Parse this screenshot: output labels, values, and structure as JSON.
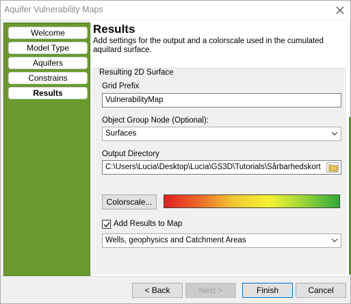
{
  "window": {
    "title": "Aquifer Vulnerability Maps"
  },
  "sidebar": {
    "items": [
      {
        "label": "Welcome",
        "active": false
      },
      {
        "label": "Model Type",
        "active": false
      },
      {
        "label": "Aquifers",
        "active": false
      },
      {
        "label": "Constrains",
        "active": false
      },
      {
        "label": "Results",
        "active": true
      }
    ],
    "background_color": "#6a9a2f"
  },
  "header": {
    "title": "Results",
    "description": "Add settings for the output and a colorscale used in the cumulated aquitard surface."
  },
  "group": {
    "label": "Resulting 2D Surface",
    "grid_prefix": {
      "label": "Grid Prefix",
      "value": "VulnerabilityMap"
    },
    "object_group_node": {
      "label": "Object Group Node (Optional):",
      "value": "Surfaces"
    },
    "output_directory": {
      "label": "Output Directory",
      "value": "C:\\Users\\Lucia\\Desktop\\Lucia\\GS3D\\Tutorials\\Sårbarhedskort"
    },
    "colorscale_button": "Colorscale...",
    "colorscale_colors": [
      "#e02020",
      "#ec6a2a",
      "#f0c832",
      "#f2f232",
      "#9ad43a",
      "#2ea83a"
    ],
    "add_results": {
      "label": "Add Results to Map",
      "checked": true
    },
    "map_select": {
      "value": "Wells, geophysics and Catchment Areas"
    }
  },
  "footer": {
    "back": "< Back",
    "next": "Next >",
    "finish": "Finish",
    "cancel": "Cancel"
  }
}
